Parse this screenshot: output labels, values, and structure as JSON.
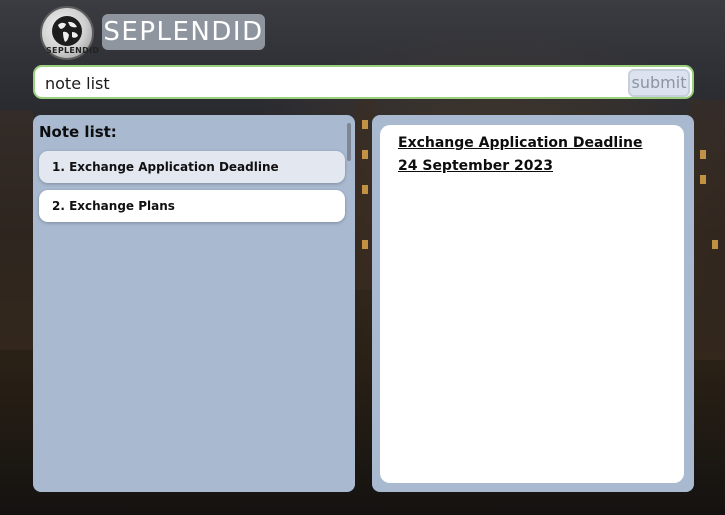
{
  "brand": {
    "logo_text": "SEPLENDID",
    "title": "SEPLENDID"
  },
  "search": {
    "value": "note list",
    "submit_label": "submit"
  },
  "note_list": {
    "heading": "Note list:",
    "items": [
      {
        "label": "1. Exchange Application Deadline",
        "selected": true
      },
      {
        "label": "2. Exchange Plans",
        "selected": false
      }
    ]
  },
  "note_view": {
    "title": "Exchange Application Deadline",
    "date": "24 September 2023"
  },
  "colors": {
    "panel": "#a8b9d0",
    "search_border": "#9ad07e",
    "brand_box": "#8e959e"
  },
  "icons": {
    "logo": "globe-icon"
  }
}
